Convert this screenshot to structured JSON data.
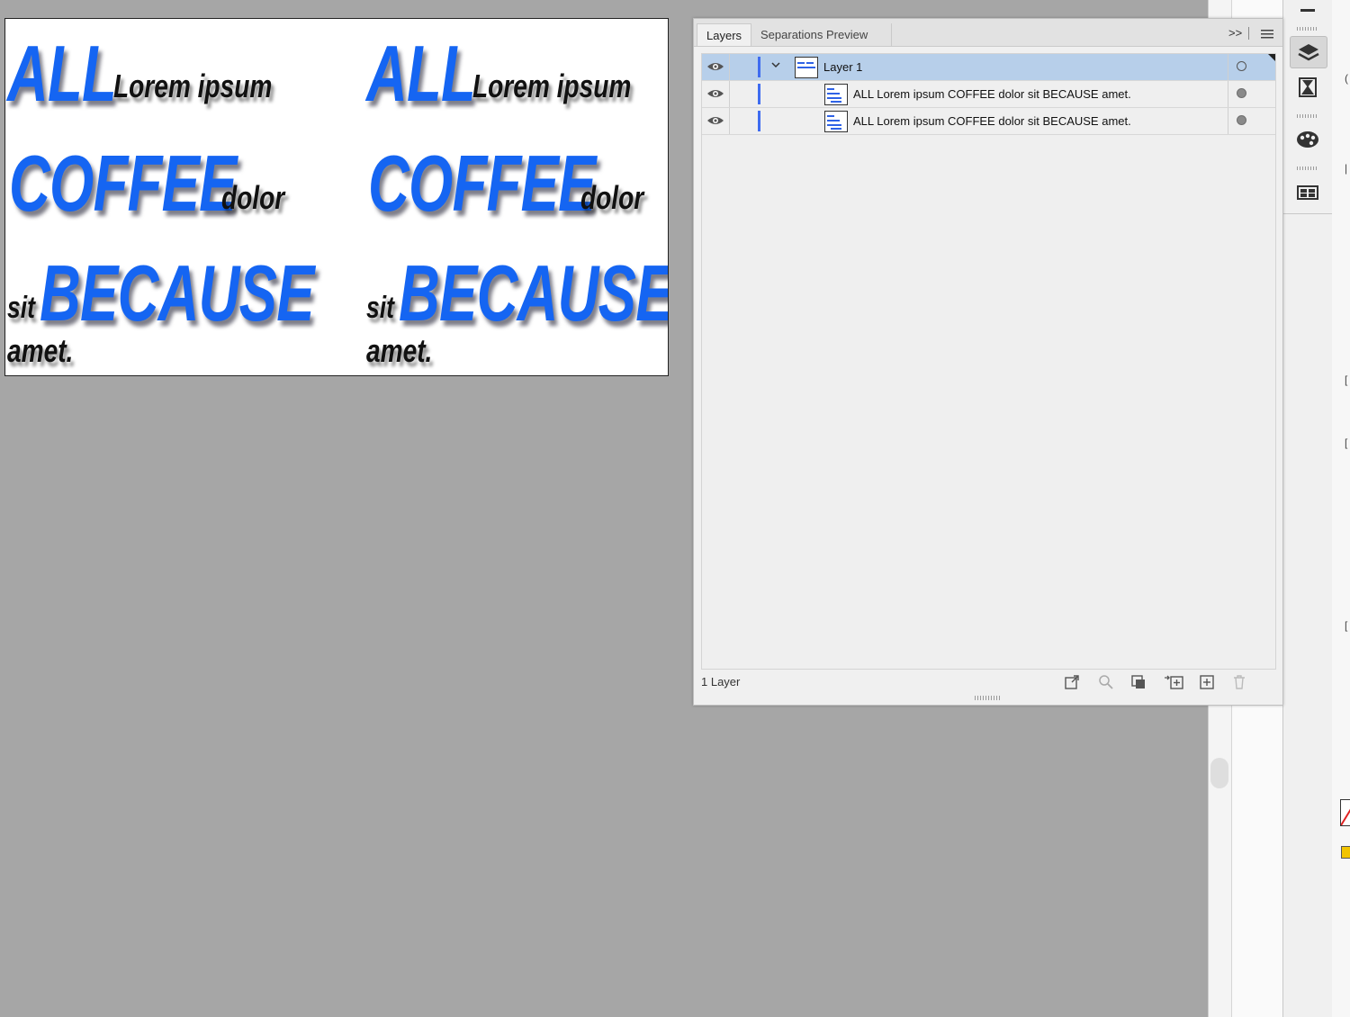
{
  "artboard": {
    "group_left": {
      "w1": "ALL",
      "w2": "Lorem ipsum",
      "w3": "COFFEE",
      "w4": "dolor",
      "w5": "sit",
      "w6": "BECAUSE",
      "w7": "amet."
    },
    "group_right": {
      "w1": "ALL",
      "w2": "Lorem ipsum",
      "w3": "COFFEE",
      "w4": "dolor",
      "w5": "sit",
      "w6": "BECAUSE",
      "w7": "amet."
    },
    "accent_color": "#1565f2"
  },
  "panel": {
    "tabs": [
      {
        "label": "Layers"
      },
      {
        "label": "Separations Preview"
      }
    ],
    "expand_label": ">>",
    "menu_icon": "hamburger-menu-icon",
    "rows": [
      {
        "label": "Layer 1",
        "selected": true
      },
      {
        "label": "ALL Lorem ipsum COFFEE dolor sit BECAUSE amet."
      },
      {
        "label": "ALL Lorem ipsum COFFEE dolor sit BECAUSE amet."
      }
    ],
    "footer": {
      "count": "1 Layer"
    },
    "layer_color": "#3f6cf0",
    "selection_color": "#b7cfea"
  },
  "toolbar_icons": [
    "layers-icon",
    "asset-export-icon",
    "color-palette-icon",
    "libraries-icon"
  ]
}
